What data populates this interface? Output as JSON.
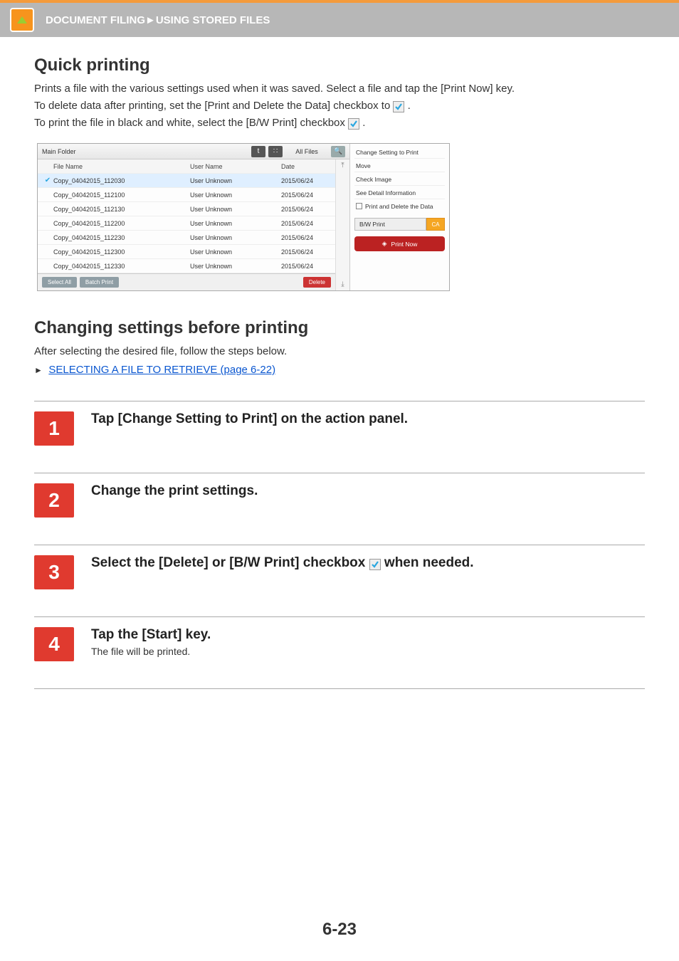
{
  "top_bar": {
    "breadcrumb": "DOCUMENT FILING►USING STORED FILES"
  },
  "quick": {
    "heading": "Quick printing",
    "p1": "Prints a file with the various settings used when it was saved. Select a file and tap the [Print Now] key.",
    "p2a": "To delete data after printing, set the [Print and Delete the Data] checkbox to ",
    "p2b": ".",
    "p3a": "To print the file in black and white, select the [B/W Print] checkbox ",
    "p3b": "."
  },
  "screenshot": {
    "main_folder": "Main Folder",
    "tab_allfiles": "All Files",
    "header": {
      "file_name": "File Name",
      "user_name": "User Name",
      "date": "Date"
    },
    "rows": [
      {
        "fn": "Copy_04042015_112030",
        "un": "User Unknown",
        "dt": "2015/06/24",
        "selected": true
      },
      {
        "fn": "Copy_04042015_112100",
        "un": "User Unknown",
        "dt": "2015/06/24",
        "selected": false
      },
      {
        "fn": "Copy_04042015_112130",
        "un": "User Unknown",
        "dt": "2015/06/24",
        "selected": false
      },
      {
        "fn": "Copy_04042015_112200",
        "un": "User Unknown",
        "dt": "2015/06/24",
        "selected": false
      },
      {
        "fn": "Copy_04042015_112230",
        "un": "User Unknown",
        "dt": "2015/06/24",
        "selected": false
      },
      {
        "fn": "Copy_04042015_112300",
        "un": "User Unknown",
        "dt": "2015/06/24",
        "selected": false
      },
      {
        "fn": "Copy_04042015_112330",
        "un": "User Unknown",
        "dt": "2015/06/24",
        "selected": false
      }
    ],
    "btn_select_all": "Select All",
    "btn_batch_print": "Batch Print",
    "btn_delete": "Delete",
    "action_panel": {
      "change_setting": "Change Setting to Print",
      "move": "Move",
      "check_image": "Check Image",
      "see_detail": "See Detail Information",
      "print_delete": "Print and Delete the Data",
      "bw_print": "B/W Print",
      "ca": "CA",
      "print_now": "Print Now"
    }
  },
  "changing": {
    "heading": "Changing settings before printing",
    "p1": "After selecting the desired file, follow the steps below.",
    "link": "SELECTING A FILE TO RETRIEVE (page 6-22)"
  },
  "steps": {
    "s1": {
      "num": "1",
      "title": "Tap [Change Setting to Print] on the action panel."
    },
    "s2": {
      "num": "2",
      "title": "Change the print settings."
    },
    "s3": {
      "num": "3",
      "title_a": "Select the [Delete] or [B/W Print] checkbox ",
      "title_b": " when needed."
    },
    "s4": {
      "num": "4",
      "title": "Tap the [Start] key.",
      "desc": "The file will be printed."
    }
  },
  "page_number": "6-23"
}
